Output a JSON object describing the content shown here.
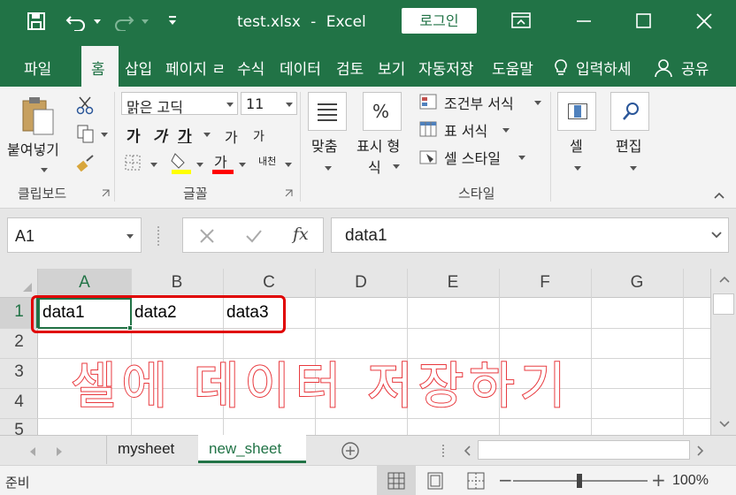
{
  "title_bar": {
    "file_name": "test.xlsx",
    "separator": "-",
    "app_name": "Excel",
    "login_label": "로그인"
  },
  "ribbon_tabs": [
    "파일",
    "홈",
    "삽입",
    "페이지 ㄹ",
    "수식",
    "데이터",
    "검토",
    "보기",
    "자동저장",
    "도움말",
    "입력하세",
    "공유"
  ],
  "ribbon": {
    "paste_label": "붙여넣기",
    "clipboard_group": "클립보드",
    "font_name": "맑은 고딕",
    "font_size": "11",
    "bold": "가",
    "italic": "가",
    "underline": "가",
    "grow_font": "가",
    "shrink_font": "가",
    "font_color_glyph": "가",
    "phonetic": "내천",
    "font_group": "글꼴",
    "align_label": "맞춤",
    "number_label_1": "표시 형",
    "number_label_2": "식",
    "percent_glyph": "%",
    "cond_format": "조건부 서식",
    "table_format": "표 서식",
    "cell_style": "셀 스타일",
    "style_group": "스타일",
    "cells_label": "셀",
    "edit_label": "편집",
    "colors": {
      "highlight": "#ffff00",
      "font_color": "#ff0000"
    }
  },
  "formula_bar": {
    "name_box": "A1",
    "fx": "fx",
    "formula": "data1"
  },
  "columns": [
    "A",
    "B",
    "C",
    "D",
    "E",
    "F",
    "G"
  ],
  "rows": [
    "1",
    "2",
    "3",
    "4",
    "5"
  ],
  "cells": {
    "A1": "data1",
    "B1": "data2",
    "C1": "data3"
  },
  "annotation": {
    "text": "셀에 데이터 저장하기",
    "color": "#e8383d"
  },
  "sheets": [
    "mysheet",
    "new_sheet"
  ],
  "active_sheet": "new_sheet",
  "status": {
    "mode": "준비",
    "zoom": "100%",
    "zoom_minus": "−",
    "zoom_plus": "+"
  },
  "accent": "#217346"
}
